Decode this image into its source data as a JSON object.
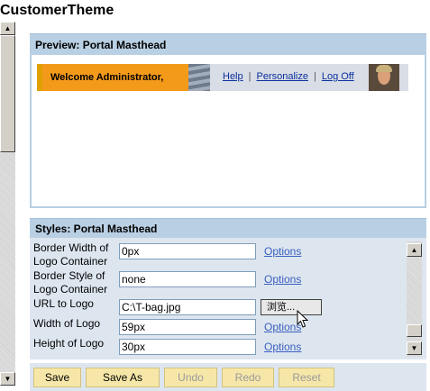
{
  "page": {
    "title": "CustomerTheme"
  },
  "preview": {
    "header": "Preview: Portal Masthead",
    "masthead": {
      "welcome": "Welcome Administrator,",
      "links": [
        "Help",
        "Personalize",
        "Log Off"
      ]
    }
  },
  "styles": {
    "header": "Styles: Portal Masthead",
    "rows": [
      {
        "label": "Border Width of Logo Container",
        "value": "0px",
        "action": "Options"
      },
      {
        "label": "Border Style of Logo Container",
        "value": "none",
        "action": "Options"
      },
      {
        "label": "URL to Logo",
        "value": "C:\\T-bag.jpg",
        "action": "浏览..."
      },
      {
        "label": "Width of Logo",
        "value": "59px",
        "action": "Options"
      },
      {
        "label": "Height of Logo",
        "value": "30px",
        "action": "Options"
      }
    ]
  },
  "buttons": {
    "save": "Save",
    "save_as": "Save As",
    "undo": "Undo",
    "redo": "Redo",
    "reset": "Reset"
  },
  "colors": {
    "panel_header": "#b9cfe3",
    "welcome_bg": "#f39a1b",
    "button_bg": "#f6e7a9",
    "link": "#3a5fbf"
  },
  "icons": {
    "scroll_up": "triangle-up",
    "scroll_down": "triangle-down",
    "cursor": "mouse-pointer"
  }
}
